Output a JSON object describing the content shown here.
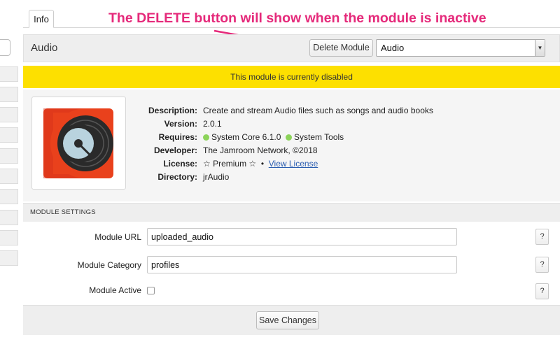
{
  "tabs": [
    {
      "label": "Info"
    }
  ],
  "annotation": {
    "text": "The DELETE button will show when the module is inactive",
    "color": "#e5297a"
  },
  "module": {
    "title": "Audio",
    "delete_label": "Delete Module",
    "selected": "Audio"
  },
  "notice": {
    "text": "This module is currently disabled",
    "color": "#fde000"
  },
  "info": {
    "description": {
      "label": "Description:",
      "value": "Create and stream Audio files such as songs and audio books"
    },
    "version": {
      "label": "Version:",
      "value": "2.0.1"
    },
    "requires": {
      "label": "Requires:",
      "items": [
        "System Core 6.1.0",
        "System Tools"
      ],
      "status_color": "#8cd35a"
    },
    "developer": {
      "label": "Developer:",
      "value": "The Jamroom Network, ©2018"
    },
    "license": {
      "label": "License:",
      "value": "☆ Premium ☆",
      "separator": "•",
      "link": "View License"
    },
    "directory": {
      "label": "Directory:",
      "value": "jrAudio"
    }
  },
  "settings": {
    "header": "MODULE SETTINGS",
    "url": {
      "label": "Module URL",
      "value": "uploaded_audio"
    },
    "category": {
      "label": "Module Category",
      "value": "profiles"
    },
    "active": {
      "label": "Module Active",
      "checked": false
    },
    "help_label": "?",
    "save_label": "Save Changes"
  }
}
